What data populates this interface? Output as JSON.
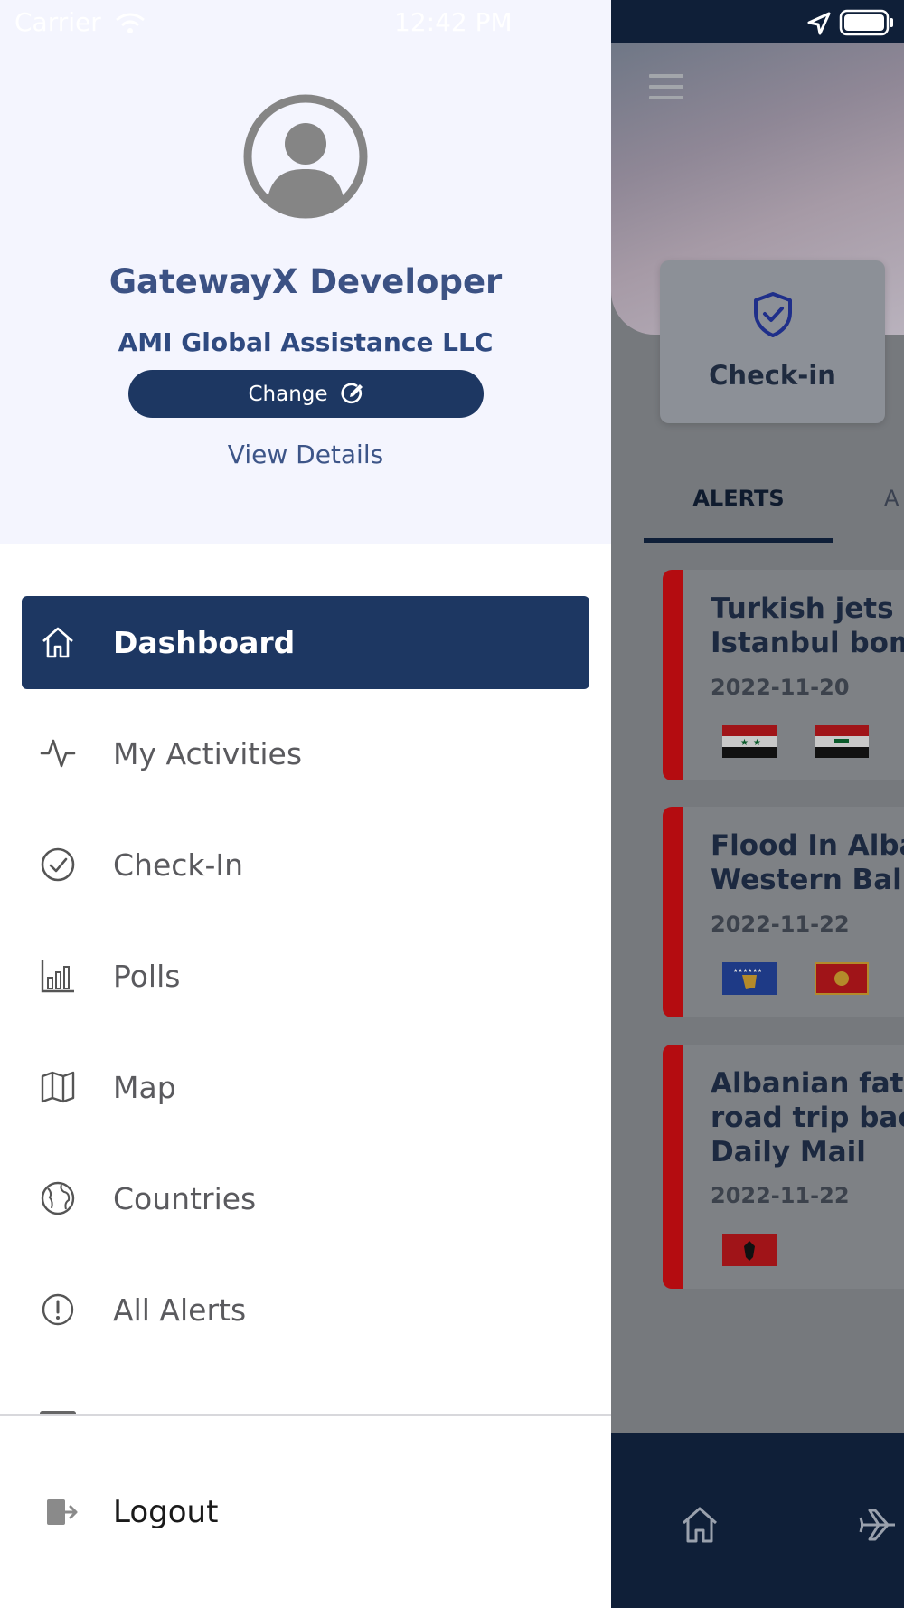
{
  "status_bar": {
    "carrier": "Carrier",
    "time": "12:42 PM"
  },
  "profile": {
    "name": "GatewayX Developer",
    "organization": "AMI Global Assistance LLC",
    "change_label": "Change",
    "view_details_label": "View Details"
  },
  "menu": {
    "items": [
      {
        "label": "Dashboard",
        "icon": "home-icon",
        "active": true
      },
      {
        "label": "My Activities",
        "icon": "activity-icon"
      },
      {
        "label": "Check-In",
        "icon": "check-circle-icon"
      },
      {
        "label": "Polls",
        "icon": "bar-chart-icon"
      },
      {
        "label": "Map",
        "icon": "map-icon"
      },
      {
        "label": "Countries",
        "icon": "globe-icon"
      },
      {
        "label": "All Alerts",
        "icon": "alert-circle-icon"
      }
    ],
    "logout_label": "Logout"
  },
  "background": {
    "checkin_label": "Check-in",
    "tab_alerts": "ALERTS",
    "tab_next": "A",
    "alerts": [
      {
        "title_line1": "Turkish jets h",
        "title_line2": "Istanbul bom",
        "date": "2022-11-20",
        "flags": [
          "Syria",
          "Iraq"
        ]
      },
      {
        "title_line1": "Flood In Alba",
        "title_line2": "Western Balk",
        "date": "2022-11-22",
        "flags": [
          "Kosovo",
          "Montenegro"
        ]
      },
      {
        "title_line1": "Albanian fath",
        "title_line2": "road trip back",
        "title_line3": "Daily Mail",
        "date": "2022-11-22",
        "flags": [
          "Albania"
        ]
      }
    ]
  },
  "colors": {
    "drawer_accent": "#1d3762",
    "alert_stripe": "#b40c10",
    "header_bg": "#f4f5fe"
  }
}
